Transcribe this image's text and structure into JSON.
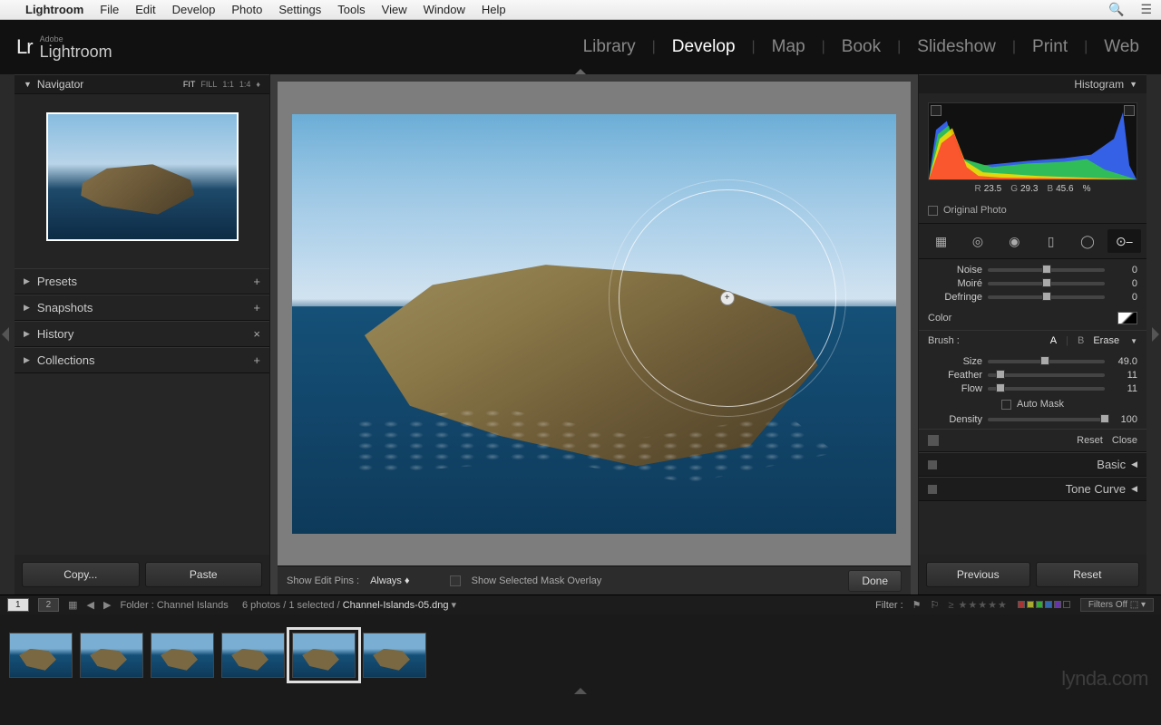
{
  "menubar": {
    "app": "Lightroom",
    "items": [
      "File",
      "Edit",
      "Develop",
      "Photo",
      "Settings",
      "Tools",
      "View",
      "Window",
      "Help"
    ]
  },
  "identity": {
    "adobe": "Adobe",
    "name": "Lightroom"
  },
  "modules": {
    "items": [
      "Library",
      "Develop",
      "Map",
      "Book",
      "Slideshow",
      "Print",
      "Web"
    ],
    "active": "Develop"
  },
  "left": {
    "navigator": {
      "title": "Navigator",
      "fit": "FIT",
      "fill": "FILL",
      "one": "1:1",
      "ratio": "1:4"
    },
    "panels": {
      "presets": {
        "title": "Presets",
        "end": "+"
      },
      "snapshots": {
        "title": "Snapshots",
        "end": "+"
      },
      "history": {
        "title": "History",
        "end": "×"
      },
      "collections": {
        "title": "Collections",
        "end": "+"
      }
    },
    "copy": "Copy...",
    "paste": "Paste"
  },
  "center": {
    "show_pins_label": "Show Edit Pins :",
    "show_pins_value": "Always",
    "overlay_label": "Show Selected Mask Overlay",
    "done": "Done"
  },
  "right": {
    "histogram_title": "Histogram",
    "rgb": {
      "r_label": "R",
      "r": "23.5",
      "g_label": "G",
      "g": "29.3",
      "b_label": "B",
      "b": "45.6",
      "pct": "%"
    },
    "original": "Original Photo",
    "sliders": {
      "noise": {
        "label": "Noise",
        "value": "0",
        "pos": 50
      },
      "moire": {
        "label": "Moiré",
        "value": "0",
        "pos": 50
      },
      "defringe": {
        "label": "Defringe",
        "value": "0",
        "pos": 50
      }
    },
    "color_label": "Color",
    "brush": {
      "label": "Brush :",
      "a": "A",
      "b": "B",
      "erase": "Erase",
      "size": {
        "label": "Size",
        "value": "49.0",
        "pos": 49
      },
      "feather": {
        "label": "Feather",
        "value": "11",
        "pos": 11
      },
      "flow": {
        "label": "Flow",
        "value": "11",
        "pos": 11
      },
      "automask": "Auto Mask",
      "density": {
        "label": "Density",
        "value": "100",
        "pos": 100
      }
    },
    "reset": "Reset",
    "close": "Close",
    "basic": "Basic",
    "tonecurve": "Tone Curve",
    "previous": "Previous",
    "reset_btn": "Reset"
  },
  "filmstrip": {
    "pages": [
      "1",
      "2"
    ],
    "folder_label": "Folder : Channel Islands",
    "count": "6 photos / 1 selected /",
    "file": "Channel-Islands-05.dng",
    "filter_label": "Filter :",
    "filters_off": "Filters Off",
    "thumbs": 6,
    "selected_index": 4
  },
  "watermark": "lynda.com"
}
